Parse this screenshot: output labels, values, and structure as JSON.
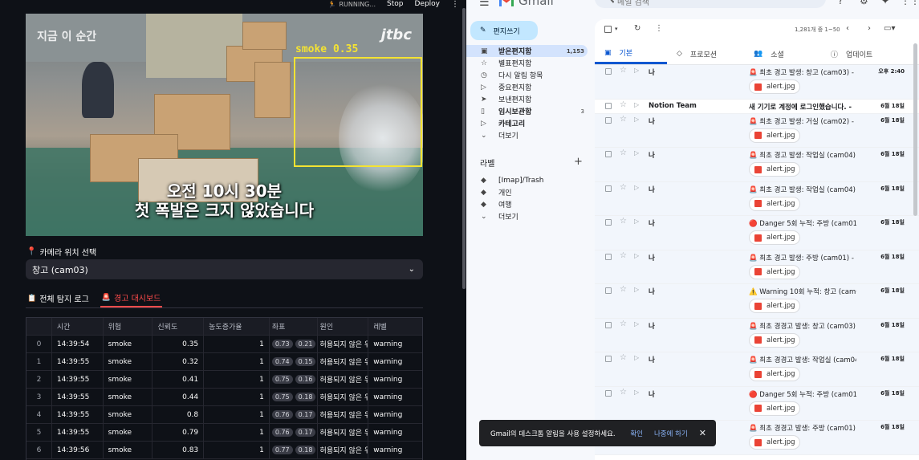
{
  "streamlit": {
    "status": "RUNNING...",
    "stop_label": "Stop",
    "deploy_label": "Deploy",
    "video": {
      "caption_top": "지금 이 순간",
      "logo": "jtbc",
      "detection_label": "smoke 0.35",
      "subtitle_line1": "오전 10시 30분",
      "subtitle_line2": "첫 폭발은 크지 않았습니다"
    },
    "camera_select_label": "카메라 위치 선택",
    "camera_selected": "창고 (cam03)",
    "tabs": [
      "전체 탐지 로그",
      "경고 대시보드"
    ],
    "table": {
      "columns": [
        "",
        "시간",
        "위험",
        "신뢰도",
        "농도증가율",
        "좌표",
        "원인",
        "레벨"
      ],
      "rows": [
        {
          "idx": "0",
          "time": "14:39:54",
          "risk": "smoke",
          "conf": "0.35",
          "inc": "1",
          "x": "0.73",
          "y": "0.21",
          "cause": "허용되지 않은 위",
          "level": "warning"
        },
        {
          "idx": "1",
          "time": "14:39:55",
          "risk": "smoke",
          "conf": "0.32",
          "inc": "1",
          "x": "0.74",
          "y": "0.15",
          "cause": "허용되지 않은 위",
          "level": "warning"
        },
        {
          "idx": "2",
          "time": "14:39:55",
          "risk": "smoke",
          "conf": "0.41",
          "inc": "1",
          "x": "0.75",
          "y": "0.16",
          "cause": "허용되지 않은 위",
          "level": "warning"
        },
        {
          "idx": "3",
          "time": "14:39:55",
          "risk": "smoke",
          "conf": "0.44",
          "inc": "1",
          "x": "0.75",
          "y": "0.18",
          "cause": "허용되지 않은 위",
          "level": "warning"
        },
        {
          "idx": "4",
          "time": "14:39:55",
          "risk": "smoke",
          "conf": "0.8",
          "inc": "1",
          "x": "0.76",
          "y": "0.17",
          "cause": "허용되지 않은 위",
          "level": "warning"
        },
        {
          "idx": "5",
          "time": "14:39:55",
          "risk": "smoke",
          "conf": "0.79",
          "inc": "1",
          "x": "0.76",
          "y": "0.17",
          "cause": "허용되지 않은 위",
          "level": "warning"
        },
        {
          "idx": "6",
          "time": "14:39:56",
          "risk": "smoke",
          "conf": "0.83",
          "inc": "1",
          "x": "0.77",
          "y": "0.18",
          "cause": "허용되지 않은 위",
          "level": "warning"
        }
      ]
    }
  },
  "gmail": {
    "brand": "Gmail",
    "search_placeholder": "메일 검색",
    "compose": "편지쓰기",
    "nav": [
      {
        "label": "받은편지함",
        "count": "1,153",
        "icon": "inbox-icon",
        "active": true
      },
      {
        "label": "별표편지함",
        "count": "",
        "icon": "star-icon"
      },
      {
        "label": "다시 알림 항목",
        "count": "",
        "icon": "clock-icon"
      },
      {
        "label": "중요편지함",
        "count": "",
        "icon": "important-icon"
      },
      {
        "label": "보낸편지함",
        "count": "",
        "icon": "send-icon"
      },
      {
        "label": "임시보관함",
        "count": "3",
        "icon": "draft-icon",
        "bold": true
      },
      {
        "label": "카테고리",
        "count": "",
        "icon": "label-icon",
        "bold": true
      },
      {
        "label": "더보기",
        "count": "",
        "icon": "chevron-down-icon"
      }
    ],
    "labels_title": "라벨",
    "labels": [
      "[Imap]/Trash",
      "개인",
      "여행",
      "더보기"
    ],
    "count_text": "1,281개 중 1~50",
    "tabs": [
      "기본",
      "프로모션",
      "소셜",
      "업데이트"
    ],
    "mails": [
      {
        "sender": "나",
        "subject": "🚨 최초 경고 발생: 창고 (cam03) -",
        "date": "오후 2:40",
        "attachment": "alert.jpg"
      },
      {
        "sender": "Notion Team",
        "subject": "새 기기로 계정에 로그인했습니다. -",
        "date": "6월 18일",
        "attachment": ""
      },
      {
        "sender": "나",
        "subject": "🚨 최초 경고 발생: 거실 (cam02) -",
        "date": "6월 18일",
        "attachment": "alert.jpg"
      },
      {
        "sender": "나",
        "subject": "🚨 최초 경고 발생: 작업실 (cam04) -",
        "date": "6월 18일",
        "attachment": "alert.jpg"
      },
      {
        "sender": "나",
        "subject": "🚨 최초 경고 발생: 작업실 (cam04) -",
        "date": "6월 18일",
        "attachment": "alert.jpg"
      },
      {
        "sender": "나",
        "subject": "🔴 Danger 5회 누적: 주방 (cam01) -",
        "date": "6월 18일",
        "attachment": "alert.jpg"
      },
      {
        "sender": "나",
        "subject": "🚨 최초 경고 발생: 주방 (cam01) -",
        "date": "6월 18일",
        "attachment": "alert.jpg"
      },
      {
        "sender": "나",
        "subject": "⚠️ Warning 10회 누적: 창고 (cam03)",
        "date": "6월 18일",
        "attachment": "alert.jpg"
      },
      {
        "sender": "나",
        "subject": "🚨 최초 경경고 발생: 창고 (cam03) -",
        "date": "6월 18일",
        "attachment": "alert.jpg"
      },
      {
        "sender": "나",
        "subject": "🚨 최초 경경고 발생: 작업실 (cam04)",
        "date": "6월 18일",
        "attachment": "alert.jpg"
      },
      {
        "sender": "나",
        "subject": "🔴 Danger 5회 누적: 주방 (cam01) -",
        "date": "6월 18일",
        "attachment": "alert.jpg"
      },
      {
        "sender": "나",
        "subject": "🚨 최초 경경고 발생: 주방 (cam01) -",
        "date": "6월 18일",
        "attachment": "alert.jpg"
      }
    ],
    "snackbar": {
      "message": "Gmail의 데스크톱 알림을 사용 설정하세요.",
      "ok": "확인",
      "later": "나중에 하기"
    }
  }
}
